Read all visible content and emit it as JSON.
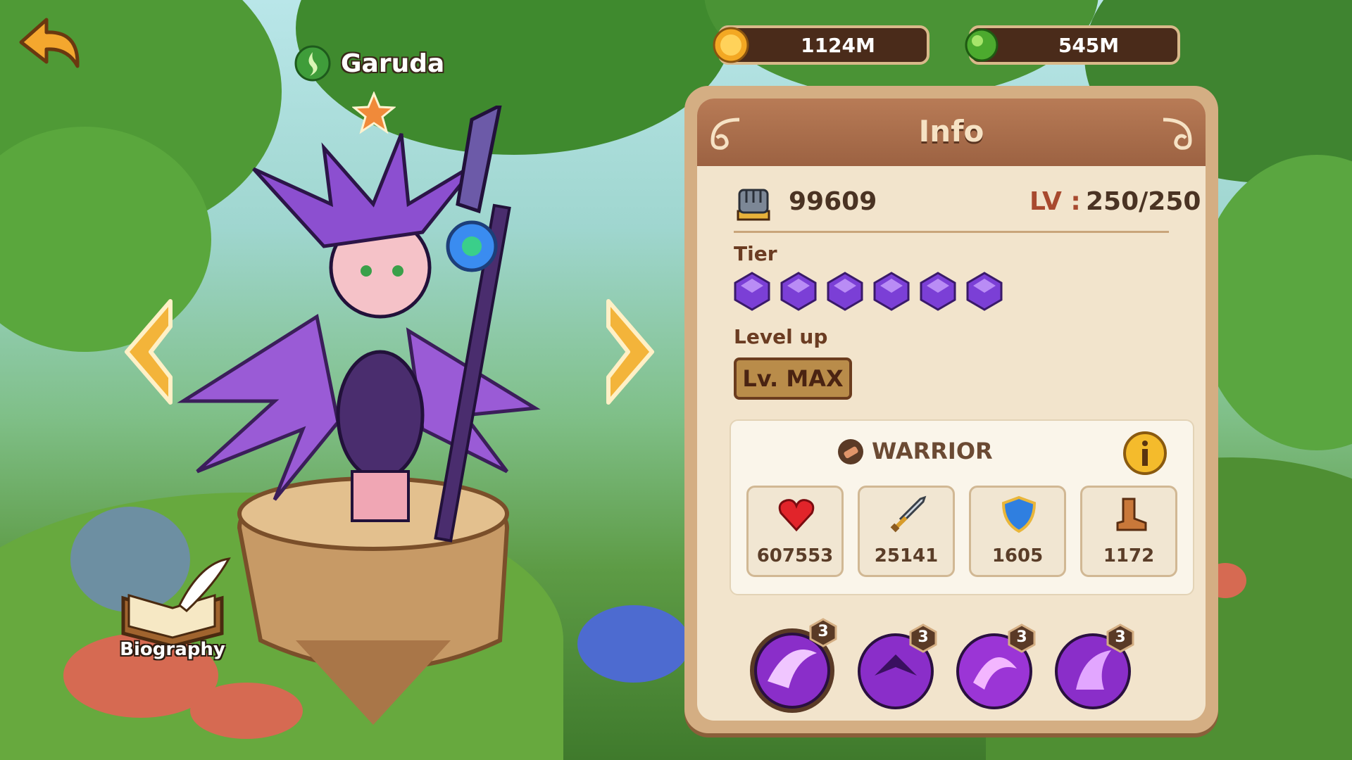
{
  "hero": {
    "name": "Garuda",
    "element": "nature-element-icon",
    "stars": 1
  },
  "currencies": [
    {
      "name": "gold",
      "icon": "gold-coin-icon",
      "value": "1124M"
    },
    {
      "name": "hero-xp",
      "icon": "green-orb-icon",
      "value": "545M"
    }
  ],
  "panel": {
    "title": "Info",
    "power": "99609",
    "level_label": "LV :",
    "level_value": "250/250",
    "tier_label": "Tier",
    "tier_gems": 6,
    "levelup_label": "Level up",
    "levelup_button": "Lv. MAX",
    "class": {
      "name": "WARRIOR",
      "icon": "warrior-class-icon",
      "info_icon": "info-icon"
    },
    "stats": [
      {
        "name": "health",
        "icon": "heart-icon",
        "value": "607553"
      },
      {
        "name": "attack",
        "icon": "sword-icon",
        "value": "25141"
      },
      {
        "name": "armor",
        "icon": "shield-icon",
        "value": "1605"
      },
      {
        "name": "speed",
        "icon": "boot-icon",
        "value": "1172"
      }
    ],
    "skills": [
      {
        "name": "skill-1",
        "level": "3"
      },
      {
        "name": "skill-2",
        "level": "3"
      },
      {
        "name": "skill-3",
        "level": "3"
      },
      {
        "name": "skill-4",
        "level": "3"
      }
    ]
  },
  "biography": {
    "label": "Biography"
  },
  "colors": {
    "panel_bg": "#f2e4cc",
    "panel_header": "#a86b4a",
    "gem": "#7b3fd6",
    "accent_red": "#a84a2f"
  }
}
